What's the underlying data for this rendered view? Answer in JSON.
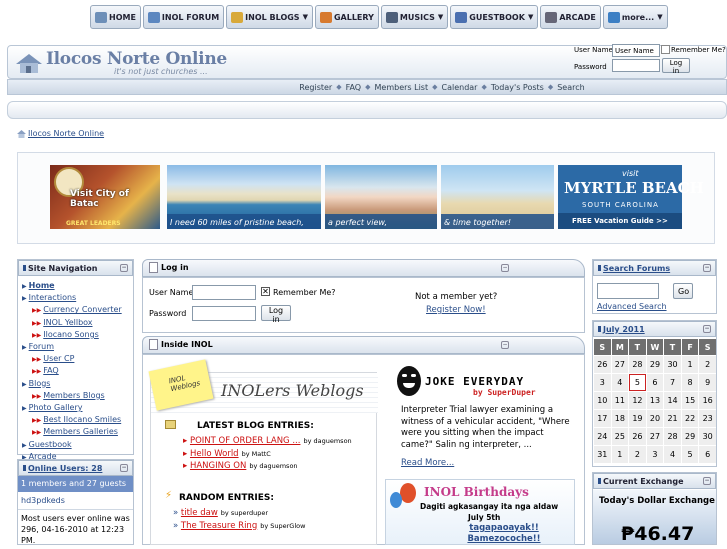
{
  "topnav": {
    "items": [
      {
        "label": "HOME",
        "dropdown": false,
        "icon": "house-icon"
      },
      {
        "label": "INOL FORUM",
        "dropdown": false,
        "icon": "forum-icon"
      },
      {
        "label": "INOL BLOGS",
        "dropdown": true,
        "icon": "blog-icon"
      },
      {
        "label": "GALLERY",
        "dropdown": false,
        "icon": "gallery-icon"
      },
      {
        "label": "MUSICS",
        "dropdown": true,
        "icon": "music-icon"
      },
      {
        "label": "GUESTBOOK",
        "dropdown": true,
        "icon": "guestbook-icon"
      },
      {
        "label": "ARCADE",
        "dropdown": false,
        "icon": "arcade-icon"
      },
      {
        "label": "more...",
        "dropdown": true,
        "icon": "globe-icon"
      }
    ]
  },
  "header": {
    "logo_title": "Ilocos Norte Online",
    "logo_tagline": "it's not just churches ...",
    "login": {
      "username_label": "User Name",
      "username_value": "User Name",
      "remember_label": "Remember Me?",
      "password_label": "Password",
      "login_button": "Log in"
    }
  },
  "subnav": [
    "Register",
    "FAQ",
    "Members List",
    "Calendar",
    "Today's Posts",
    "Search"
  ],
  "breadcrumb": "Ilocos Norte Online",
  "banner": {
    "batac_line1": "Visit City of Batac",
    "batac_tagline": "GREAT LEADERS",
    "beach_caption1": "I need 60 miles of pristine beach,",
    "beach_caption2": "a perfect view,",
    "beach_caption3": "& time together!",
    "myrtle_visit": "visit",
    "myrtle_title": "MYRTLE BEACH",
    "myrtle_state": "SOUTH CAROLINA",
    "myrtle_free": "FREE Vacation Guide >>"
  },
  "sidebar_left": {
    "nav_title": "Site Navigation",
    "nav_items": [
      {
        "label": "Home",
        "level": 0,
        "bold": true
      },
      {
        "label": "Interactions",
        "level": 0
      },
      {
        "label": "Currency Converter",
        "level": 1
      },
      {
        "label": "INOL Yellbox",
        "level": 1
      },
      {
        "label": "Ilocano Songs",
        "level": 1
      },
      {
        "label": "Forum",
        "level": 0
      },
      {
        "label": "User CP",
        "level": 1
      },
      {
        "label": "FAQ",
        "level": 1
      },
      {
        "label": "Blogs",
        "level": 0
      },
      {
        "label": "Members Blogs",
        "level": 1
      },
      {
        "label": "Photo Gallery",
        "level": 0
      },
      {
        "label": "Best Ilocano Smiles",
        "level": 1
      },
      {
        "label": "Members Galleries",
        "level": 1
      },
      {
        "label": "Guestbook",
        "level": 0
      },
      {
        "label": "Arcade",
        "level": 0
      }
    ],
    "online_title": "Online Users: 28",
    "online_summary": "1 members and 27 guests",
    "online_member": "hd3pdkeds",
    "most_online": "Most users ever online was 296, 04-16-2010 at 12:23 PM."
  },
  "center": {
    "login_title": "Log in",
    "username_label": "User Name",
    "password_label": "Password",
    "remember_label": "Remember Me?",
    "login_button": "Log in",
    "not_member": "Not a member yet?",
    "register_now": "Register Now!",
    "inside_title": "Inside INOL",
    "sticky_note": "INOL Weblogs",
    "weblogs_title": "INOLers Weblogs",
    "latest_blog_label": "LATEST BLOG ENTRIES:",
    "latest_blogs": [
      {
        "title": "POINT OF ORDER LANG ...",
        "by": "by daguemson"
      },
      {
        "title": "Hello World",
        "by": "by MattC"
      },
      {
        "title": "HANGING ON",
        "by": "by daguemson"
      }
    ],
    "random_label": "RANDOM ENTRIES:",
    "random_entries": [
      {
        "title": "title daw",
        "by": "by superduper"
      },
      {
        "title": "The Treasure Ring",
        "by": "by SuperGlow"
      }
    ],
    "joke_title": "JOKE EVERYDAY",
    "joke_byline": "by SuperDuper",
    "joke_text": "Interpreter Trial lawyer examining a witness of a vehicular accident, \"Where were you sitting when the impact came?\" Salin ng interpreter, ...",
    "read_more": "Read More...",
    "birthday_title": "INOL Birthdays",
    "birthday_sub": "Dagiti agkasangay ita nga aldaw",
    "birthday_date": "July 5th",
    "birthday_names": [
      "tagapaoayak!!",
      "Bamezocoche!!"
    ]
  },
  "sidebar_right": {
    "search_title": "Search Forums",
    "go_button": "Go",
    "advanced_search": "Advanced Search",
    "calendar_title": "July 2011",
    "weekdays": [
      "S",
      "M",
      "T",
      "W",
      "T",
      "F",
      "S"
    ],
    "weeks": [
      [
        "26",
        "27",
        "28",
        "29",
        "30",
        "1",
        "2"
      ],
      [
        "3",
        "4",
        "5",
        "6",
        "7",
        "8",
        "9"
      ],
      [
        "10",
        "11",
        "12",
        "13",
        "14",
        "15",
        "16"
      ],
      [
        "17",
        "18",
        "19",
        "20",
        "21",
        "22",
        "23"
      ],
      [
        "24",
        "25",
        "26",
        "27",
        "28",
        "29",
        "30"
      ],
      [
        "31",
        "1",
        "2",
        "3",
        "4",
        "5",
        "6"
      ]
    ],
    "today": "5",
    "exchange_title": "Current Exchange",
    "exchange_heading": "Today's Dollar Exchange",
    "exchange_rate": "₱46.47"
  },
  "colors": {
    "link": "#2a4e8a",
    "red_link": "#cc1111",
    "header_blue": "#6f8fc6",
    "calendar_head": "#6f6f6f",
    "today_border": "#cc2222"
  }
}
